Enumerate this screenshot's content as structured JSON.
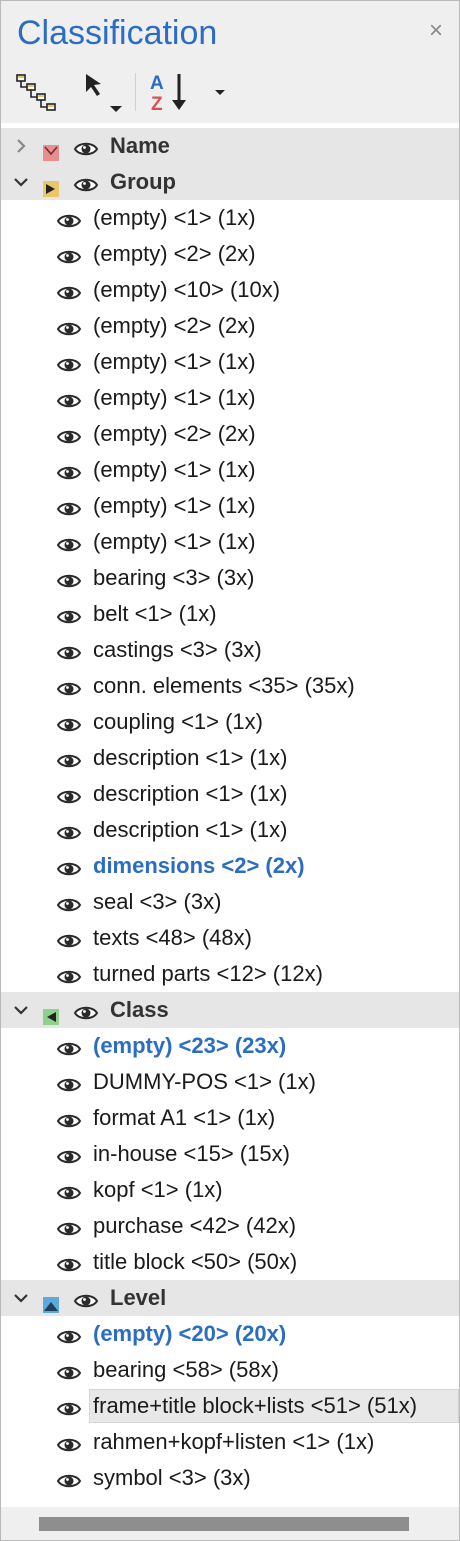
{
  "title": "Classification",
  "close_glyph": "×",
  "toolbar": {
    "tree_icon": "tree-structure-icon",
    "select_icon": "pointer-arrow-icon",
    "sort_icon": "sort-az-icon",
    "dropdown_icon": "chevron-down-icon"
  },
  "colors": {
    "accent": "#2b6cc4",
    "name_icon": "#e58f8f",
    "group_icon": "#e9c76a",
    "class_icon": "#8fd08f",
    "level_icon": "#5fa8dc"
  },
  "groups": [
    {
      "label": "Name",
      "expanded": false,
      "icon": "name-icon"
    },
    {
      "label": "Group",
      "expanded": true,
      "icon": "group-icon",
      "items": [
        "(empty) <1> (1x)",
        "(empty) <2> (2x)",
        "(empty) <10> (10x)",
        "(empty) <2> (2x)",
        "(empty) <1> (1x)",
        "(empty) <1> (1x)",
        "(empty) <2> (2x)",
        "(empty) <1> (1x)",
        "(empty) <1> (1x)",
        "(empty) <1> (1x)",
        "bearing <3> (3x)",
        "belt <1> (1x)",
        "castings <3> (3x)",
        "conn. elements <35> (35x)",
        "coupling <1> (1x)",
        "description <1> (1x)",
        "description <1> (1x)",
        "description <1> (1x)",
        "dimensions <2> (2x)",
        "seal <3> (3x)",
        "texts <48> (48x)",
        "turned parts <12> (12x)"
      ],
      "highlight": [
        18
      ]
    },
    {
      "label": "Class",
      "expanded": true,
      "icon": "class-icon",
      "items": [
        "(empty) <23> (23x)",
        "DUMMY-POS <1> (1x)",
        "format A1 <1> (1x)",
        "in-house <15> (15x)",
        "kopf <1> (1x)",
        "purchase <42> (42x)",
        "title block <50> (50x)"
      ],
      "highlight": [
        0
      ]
    },
    {
      "label": "Level",
      "expanded": true,
      "icon": "level-icon",
      "items": [
        "(empty) <20> (20x)",
        "bearing <58> (58x)",
        "frame+title block+lists <51> (51x)",
        "rahmen+kopf+listen <1> (1x)",
        "symbol <3> (3x)"
      ],
      "highlight": [
        0
      ],
      "selected": 2
    }
  ]
}
